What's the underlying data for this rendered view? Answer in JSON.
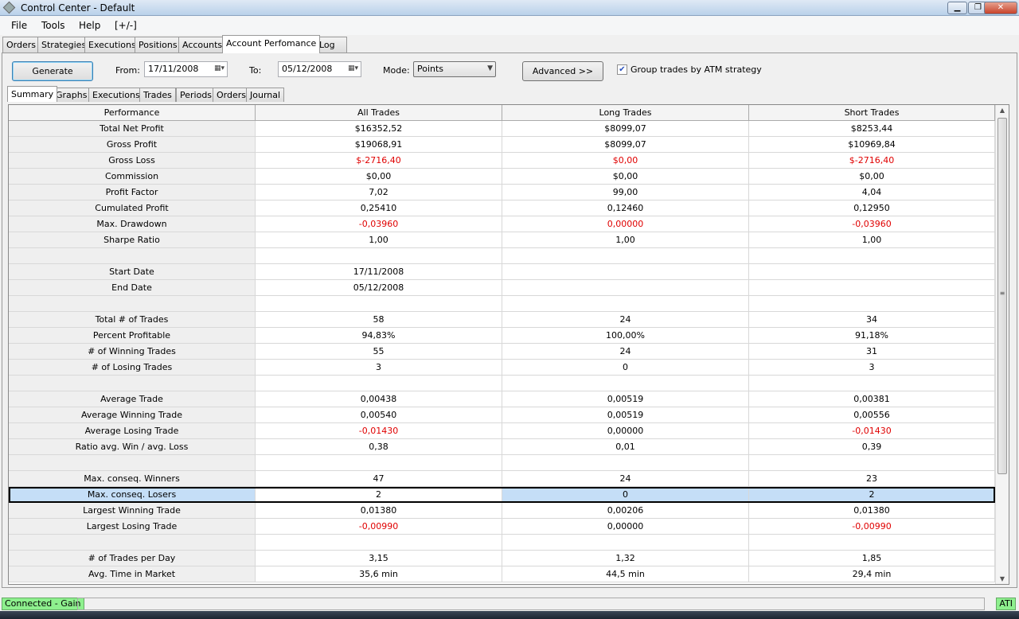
{
  "window": {
    "title": "Control Center - Default"
  },
  "menu": {
    "file": "File",
    "tools": "Tools",
    "help": "Help",
    "toggle": "[+/-]"
  },
  "outer_tabs": [
    "Orders",
    "Strategies",
    "Executions",
    "Positions",
    "Accounts",
    "Account Perfomance",
    "Log"
  ],
  "outer_active": "Account Perfomance",
  "toolbar": {
    "generate": "Generate",
    "from_label": "From:",
    "from_value": "17/11/2008",
    "to_label": "To:",
    "to_value": "05/12/2008",
    "mode_label": "Mode:",
    "mode_value": "Points",
    "advanced": "Advanced >>",
    "group_label": "Group trades by ATM strategy",
    "group_checked": true
  },
  "inner_tabs": [
    "Summary",
    "Graphs",
    "Executions",
    "Trades",
    "Periods",
    "Orders",
    "Journal"
  ],
  "inner_active": "Summary",
  "table": {
    "headers": [
      "Performance",
      "All Trades",
      "Long Trades",
      "Short Trades"
    ],
    "negative_color": "#e00000",
    "selected_row": 23,
    "rows": [
      {
        "label": "Total Net Profit",
        "all": "$16352,52",
        "long": "$8099,07",
        "short": "$8253,44"
      },
      {
        "label": "Gross Profit",
        "all": "$19068,91",
        "long": "$8099,07",
        "short": "$10969,84"
      },
      {
        "label": "Gross Loss",
        "all": "$-2716,40",
        "long": "$0,00",
        "short": "$-2716,40",
        "red": [
          true,
          true,
          true
        ]
      },
      {
        "label": "Commission",
        "all": "$0,00",
        "long": "$0,00",
        "short": "$0,00"
      },
      {
        "label": "Profit Factor",
        "all": "7,02",
        "long": "99,00",
        "short": "4,04"
      },
      {
        "label": "Cumulated Profit",
        "all": "0,25410",
        "long": "0,12460",
        "short": "0,12950"
      },
      {
        "label": "Max. Drawdown",
        "all": "-0,03960",
        "long": "0,00000",
        "short": "-0,03960",
        "red": [
          true,
          true,
          true
        ]
      },
      {
        "label": "Sharpe Ratio",
        "all": "1,00",
        "long": "1,00",
        "short": "1,00"
      },
      {
        "label": "",
        "all": "",
        "long": "",
        "short": ""
      },
      {
        "label": "Start Date",
        "all": "17/11/2008",
        "long": "",
        "short": ""
      },
      {
        "label": "End Date",
        "all": "05/12/2008",
        "long": "",
        "short": ""
      },
      {
        "label": "",
        "all": "",
        "long": "",
        "short": ""
      },
      {
        "label": "Total # of Trades",
        "all": "58",
        "long": "24",
        "short": "34"
      },
      {
        "label": "Percent Profitable",
        "all": "94,83%",
        "long": "100,00%",
        "short": "91,18%"
      },
      {
        "label": "# of Winning Trades",
        "all": "55",
        "long": "24",
        "short": "31"
      },
      {
        "label": "# of Losing Trades",
        "all": "3",
        "long": "0",
        "short": "3"
      },
      {
        "label": "",
        "all": "",
        "long": "",
        "short": ""
      },
      {
        "label": "Average Trade",
        "all": "0,00438",
        "long": "0,00519",
        "short": "0,00381"
      },
      {
        "label": "Average Winning Trade",
        "all": "0,00540",
        "long": "0,00519",
        "short": "0,00556"
      },
      {
        "label": "Average Losing Trade",
        "all": "-0,01430",
        "long": "0,00000",
        "short": "-0,01430",
        "red": [
          true,
          false,
          true
        ]
      },
      {
        "label": "Ratio avg. Win / avg. Loss",
        "all": "0,38",
        "long": "0,01",
        "short": "0,39"
      },
      {
        "label": "",
        "all": "",
        "long": "",
        "short": ""
      },
      {
        "label": "Max. conseq. Winners",
        "all": "47",
        "long": "24",
        "short": "23"
      },
      {
        "label": "Max. conseq. Losers",
        "all": "2",
        "long": "0",
        "short": "2"
      },
      {
        "label": "Largest Winning Trade",
        "all": "0,01380",
        "long": "0,00206",
        "short": "0,01380"
      },
      {
        "label": "Largest Losing Trade",
        "all": "-0,00990",
        "long": "0,00000",
        "short": "-0,00990",
        "red": [
          true,
          false,
          true
        ]
      },
      {
        "label": "",
        "all": "",
        "long": "",
        "short": ""
      },
      {
        "label": "# of Trades per Day",
        "all": "3,15",
        "long": "1,32",
        "short": "1,85"
      },
      {
        "label": "Avg. Time in Market",
        "all": "35,6 min",
        "long": "44,5 min",
        "short": "29,4 min"
      }
    ]
  },
  "status": {
    "connection": "Connected - Gain",
    "provider": "ATI"
  }
}
